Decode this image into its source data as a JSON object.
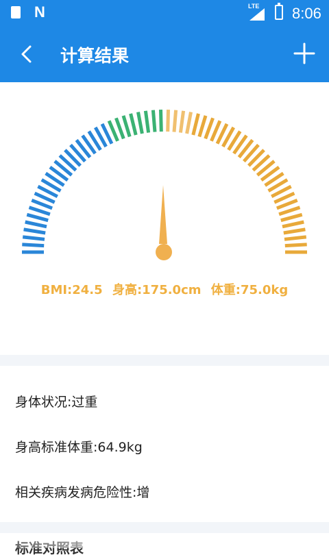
{
  "status_bar": {
    "notification_icons": [
      "sd-card-icon",
      "n-icon"
    ],
    "network_label": "LTE",
    "time": "8:06"
  },
  "app_bar": {
    "title": "计算结果",
    "back_icon": "chevron-left-icon",
    "action_icon": "plus-icon"
  },
  "gauge": {
    "segment_colors": [
      "#2a86d8",
      "#3bb273",
      "#f0c070",
      "#e8a93a"
    ],
    "needle_color": "#f0b050"
  },
  "result": {
    "bmi": "BMI:24.5",
    "height": "身高:175.0cm",
    "weight": "体重:75.0kg"
  },
  "info": {
    "status": "身体状况:过重",
    "standard_weight": "身高标准体重:64.9kg",
    "risk": "相关疾病发病危险性:增"
  },
  "section_title": "标准对照表"
}
